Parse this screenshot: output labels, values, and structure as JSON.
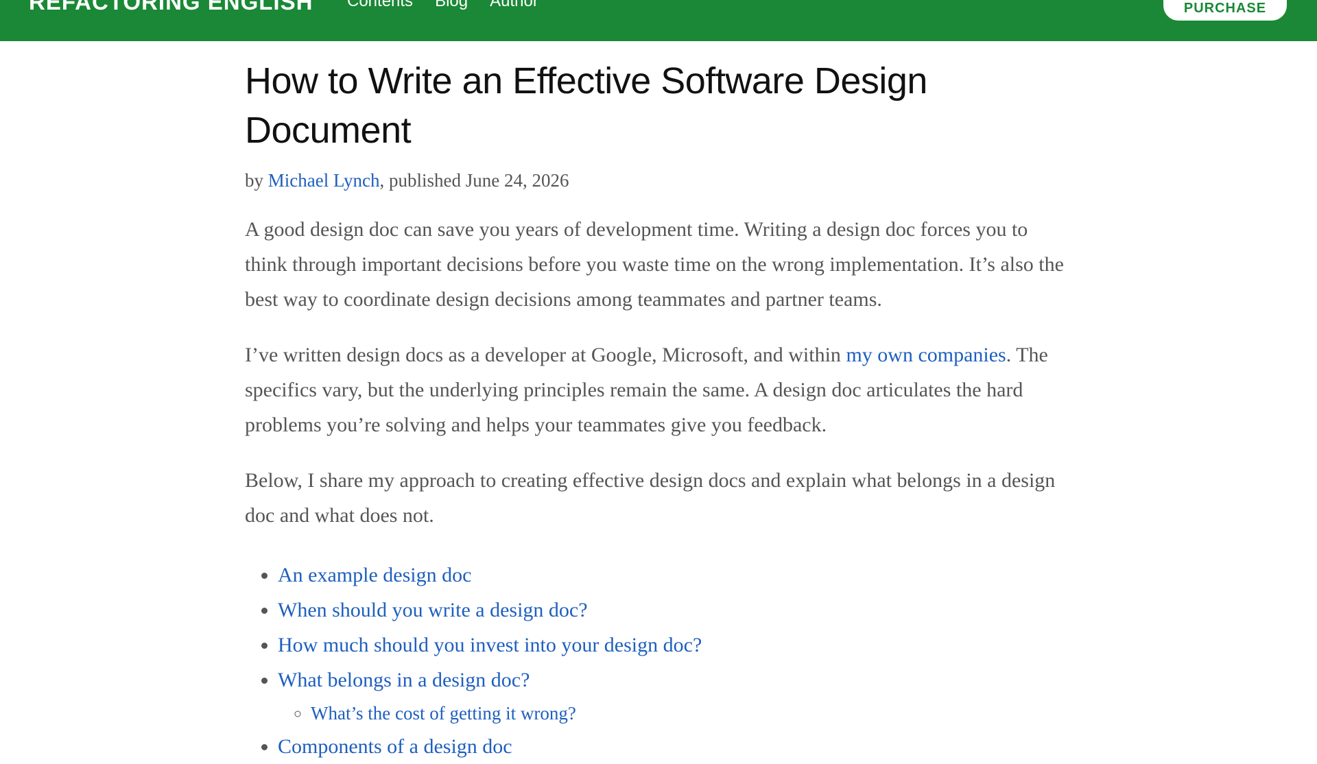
{
  "header": {
    "brand": "REFACTORING ENGLISH",
    "nav": [
      "Contents",
      "Blog",
      "Author"
    ],
    "purchase_label": "PURCHASE"
  },
  "article": {
    "title_line1": "How to Write an Effective Software Design",
    "title_line2": "Document",
    "byline": {
      "prefix": "by ",
      "author": "Michael Lynch",
      "suffix": ", published June 24, 2026"
    },
    "para1": "A good design doc can save you years of development time. Writing a design doc forces you to think through important decisions before you waste time on the wrong implementation. It’s also the best way to coordinate design decisions among teammates and partner teams.",
    "para2": {
      "before": "I’ve written design docs as a developer at Google, Microsoft, and within ",
      "link": "my own companies",
      "after": ". The specifics vary, but the underlying principles remain the same. A design doc articulates the hard problems you’re solving and helps your teammates give you feedback."
    },
    "para3": "Below, I share my approach to creating effective design docs and explain what belongs in a design doc and what does not.",
    "toc": {
      "items": [
        "An example design doc",
        "When should you write a design doc?",
        "How much should you invest into your design doc?",
        "What belongs in a design doc?",
        "Components of a design doc"
      ],
      "subitems": [
        "What’s the cost of getting it wrong?"
      ]
    }
  },
  "colors": {
    "header_bg": "#1a8836",
    "link": "#1e5fbf",
    "body_text": "#555555"
  }
}
